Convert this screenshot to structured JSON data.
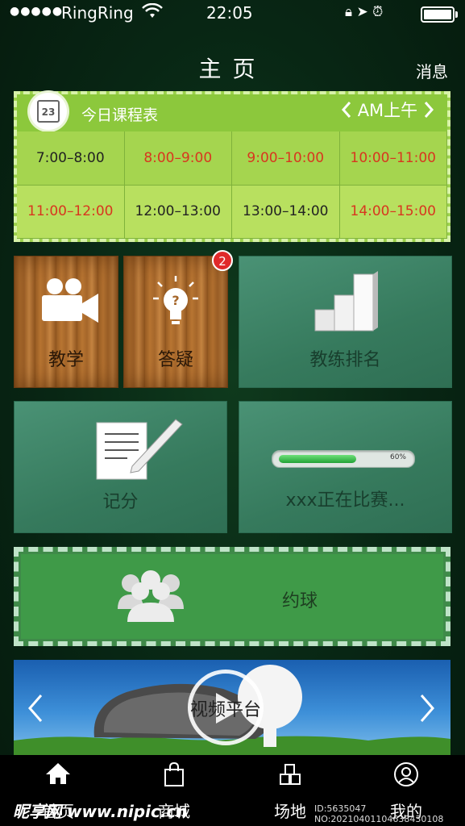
{
  "status_bar": {
    "signal": "●●●●●",
    "carrier": "RingRing",
    "time": "22:05",
    "battery_level": 1.0
  },
  "header": {
    "title": "主页",
    "messages_label": "消息"
  },
  "schedule": {
    "calendar_day": "23",
    "title": "今日课程表",
    "period_label": "AM上午",
    "slots": [
      {
        "time": "7:00–8:00",
        "highlight": false
      },
      {
        "time": "8:00–9:00",
        "highlight": true
      },
      {
        "time": "9:00–10:00",
        "highlight": true
      },
      {
        "time": "10:00–11:00",
        "highlight": true
      },
      {
        "time": "11:00–12:00",
        "highlight": true
      },
      {
        "time": "12:00–13:00",
        "highlight": false
      },
      {
        "time": "13:00–14:00",
        "highlight": false
      },
      {
        "time": "14:00–15:00",
        "highlight": true
      }
    ]
  },
  "tiles": {
    "teaching": "教学",
    "qa": "答疑",
    "qa_badge": "2",
    "coach_ranking": "教练排名",
    "scoring": "记分",
    "match_status": "xxx正在比赛...",
    "match_progress_label": "60%",
    "match_progress": 0.6
  },
  "booking": {
    "label": "约球"
  },
  "video": {
    "label": "视频平台"
  },
  "tabbar": {
    "items": [
      {
        "label": "首页",
        "icon": "home-icon"
      },
      {
        "label": "商城",
        "icon": "shopping-bag-icon"
      },
      {
        "label": "场地",
        "icon": "venue-icon"
      },
      {
        "label": "我的",
        "icon": "user-icon"
      }
    ]
  },
  "watermark": {
    "brand": "昵享网 www.nipic.cn",
    "id_text": "ID:5635047 NO:20210401104638430108"
  },
  "colors": {
    "schedule_green": "#9bd14b",
    "highlight_red": "#d8361f",
    "teal_tile": "#3c8466",
    "booking_green": "#3f9a48"
  }
}
